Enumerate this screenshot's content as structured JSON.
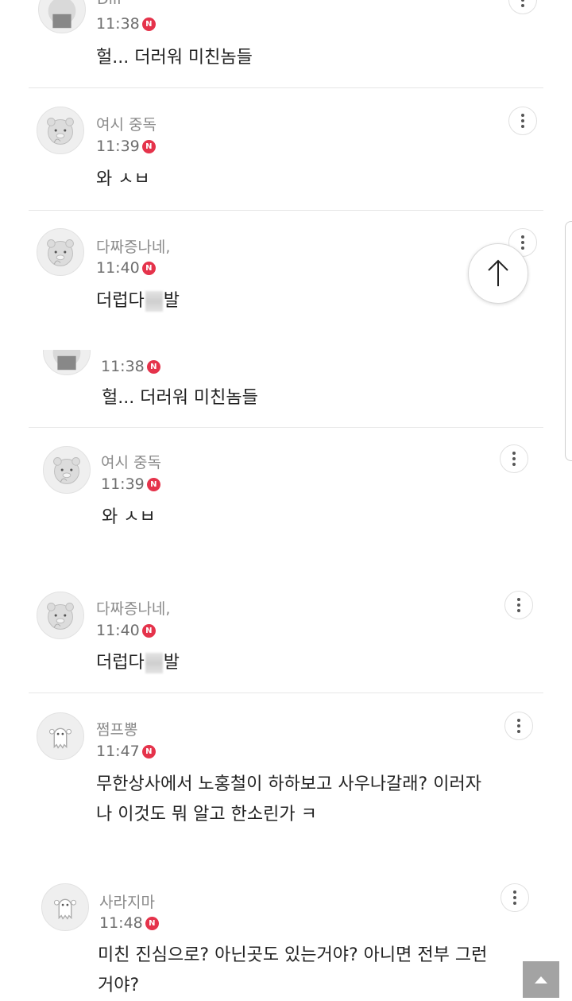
{
  "comments": [
    {
      "author": "Dlil",
      "time": "11:38",
      "badge": "N",
      "body": "헐... 더러워 미친놈들"
    },
    {
      "author": "여시 중독",
      "time": "11:39",
      "badge": "N",
      "body": "와 ㅅㅂ"
    },
    {
      "author": "다짜증나네,",
      "time": "11:40",
      "badge": "N",
      "body_prefix": "더럽다",
      "body_suffix": "발"
    },
    {
      "time": "11:38",
      "badge": "N",
      "body": "헐... 더러워 미친놈들"
    },
    {
      "author": "여시 중독",
      "time": "11:39",
      "badge": "N",
      "body": "와 ㅅㅂ"
    },
    {
      "author": "다짜증나네,",
      "time": "11:40",
      "badge": "N",
      "body_prefix": "더럽다",
      "body_suffix": "발"
    },
    {
      "author": "쩜프뽕",
      "time": "11:47",
      "badge": "N",
      "body_lines": [
        "무한상사에서 노홍철이 하하보고 사우나갈래? 이러자",
        "나 이것도 뭐 알고 한소린가 ㅋ"
      ]
    },
    {
      "author": "사라지마",
      "time": "11:48",
      "badge": "N",
      "body_lines": [
        "미친 진심으로? 아닌곳도 있는거야? 아니면 전부 그런",
        "거야?"
      ]
    }
  ],
  "icons": {
    "more": "more-vertical-icon",
    "scroll_up": "arrow-up-icon",
    "top": "caret-up-icon",
    "avatar_ryan": "ryan-character-icon",
    "avatar_ghost": "ghost-character-icon"
  },
  "colors": {
    "badge": "#e5334b",
    "divider": "#e6e6e6",
    "top_button": "#a3a3a3"
  }
}
